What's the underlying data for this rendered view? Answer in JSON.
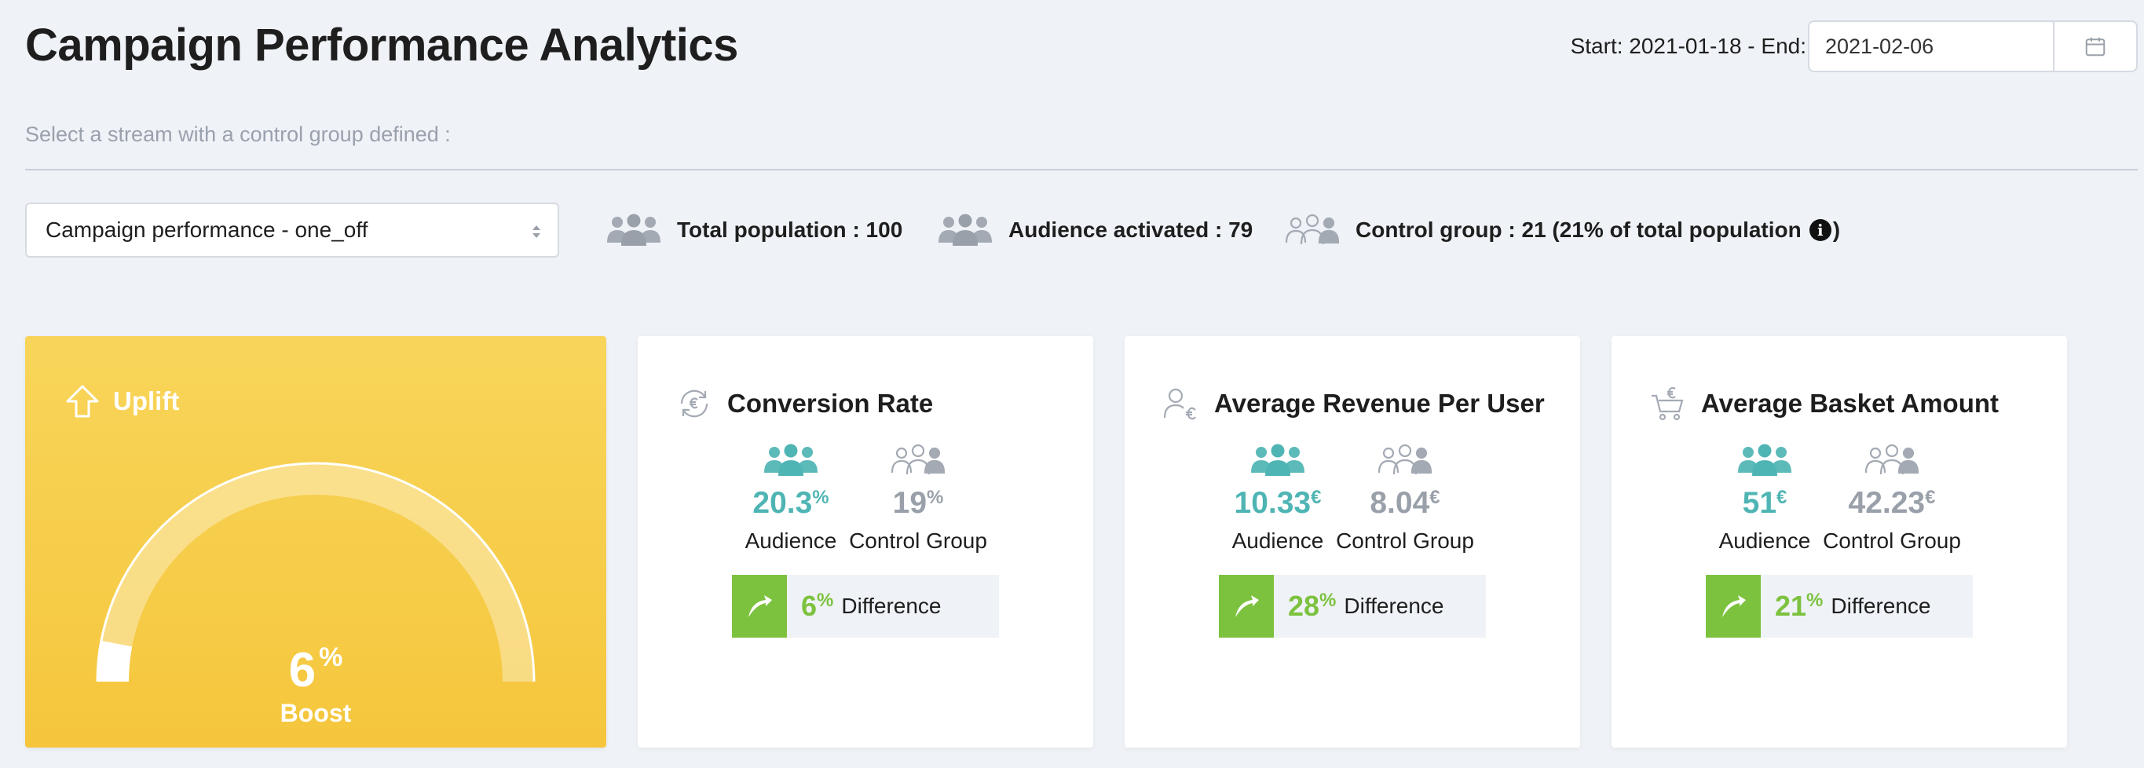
{
  "header": {
    "title": "Campaign Performance Analytics",
    "date_label": "Start: 2021-01-18 - End:",
    "end_date": "2021-02-06"
  },
  "stream": {
    "prompt": "Select a stream with a control group defined :",
    "selected": "Campaign performance - one_off"
  },
  "stats": {
    "total": "Total population : 100",
    "activated": "Audience activated : 79",
    "control": "Control group : 21 (21% of total population",
    "control_close": ")",
    "info_glyph": "i"
  },
  "uplift": {
    "title": "Uplift",
    "value": "6",
    "unit": "%",
    "label": "Boost",
    "gauge_fraction": 0.06
  },
  "metrics": [
    {
      "title": "Conversion Rate",
      "icon": "conversion-icon",
      "audience_value": "20.3",
      "audience_unit": "%",
      "audience_label": "Audience",
      "control_value": "19",
      "control_unit": "%",
      "control_label": "Control Group",
      "diff_value": "6",
      "diff_unit": "%",
      "diff_label": "Difference"
    },
    {
      "title": "Average Revenue Per User",
      "icon": "user-euro-icon",
      "audience_value": "10.33",
      "audience_unit": "€",
      "audience_label": "Audience",
      "control_value": "8.04",
      "control_unit": "€",
      "control_label": "Control Group",
      "diff_value": "28",
      "diff_unit": "%",
      "diff_label": "Difference"
    },
    {
      "title": "Average Basket Amount",
      "icon": "cart-euro-icon",
      "audience_value": "51",
      "audience_unit": "€",
      "audience_label": "Audience",
      "control_value": "42.23",
      "control_unit": "€",
      "control_label": "Control Group",
      "diff_value": "21",
      "diff_unit": "%",
      "diff_label": "Difference"
    }
  ],
  "colors": {
    "accent_yellow": "#f7cd4a",
    "audience_teal": "#4fb5b4",
    "control_gray": "#9aa0aa",
    "positive_green": "#7dc23f",
    "background": "#eff2f7"
  }
}
